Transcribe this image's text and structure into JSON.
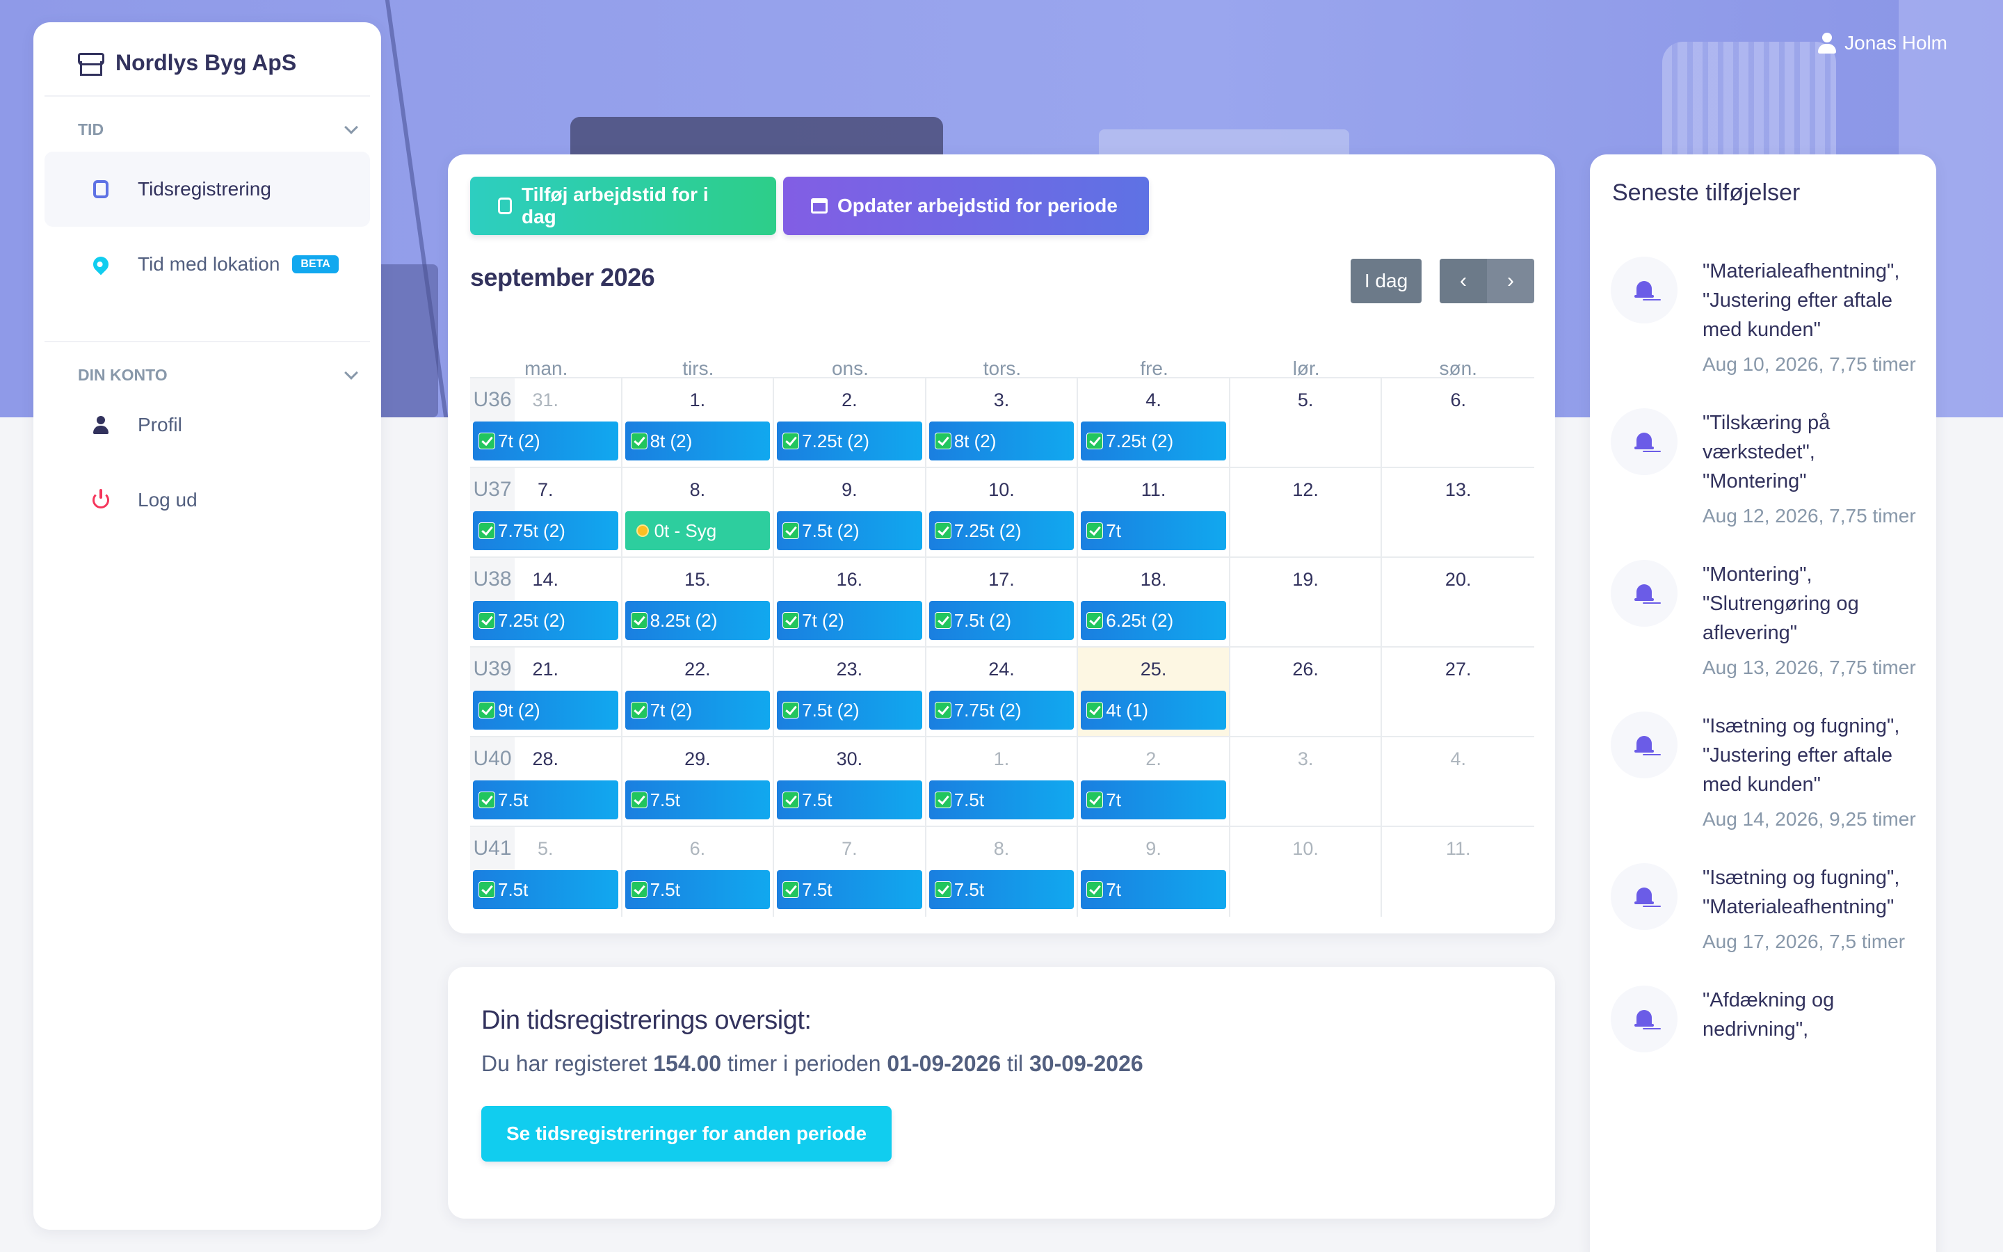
{
  "user": {
    "name": "Jonas Holm"
  },
  "sidebar": {
    "brand": "Nordlys Byg ApS",
    "sections": [
      {
        "title": "TID",
        "items": [
          {
            "label": "Tidsregistrering",
            "icon": "stopwatch-icon",
            "active": true
          },
          {
            "label": "Tid med lokation",
            "icon": "map-pin-icon",
            "badge": "BETA"
          }
        ]
      },
      {
        "title": "DIN KONTO",
        "items": [
          {
            "label": "Profil",
            "icon": "user-icon"
          },
          {
            "label": "Log ud",
            "icon": "power-icon"
          }
        ]
      }
    ]
  },
  "calendar": {
    "add_today_label": "Tilføj arbejdstid for i dag",
    "update_period_label": "Opdater arbejdstid for periode",
    "month_title": "september 2026",
    "today_label": "I dag",
    "prev_label": "‹",
    "next_label": "›",
    "weekdays": [
      "man.",
      "tirs.",
      "ons.",
      "tors.",
      "fre.",
      "lør.",
      "søn."
    ],
    "weeks": [
      {
        "label": "U36",
        "days": [
          {
            "n": "31.",
            "dim": true,
            "ev": "7t (2)"
          },
          {
            "n": "1.",
            "ev": "8t (2)"
          },
          {
            "n": "2.",
            "ev": "7.25t (2)"
          },
          {
            "n": "3.",
            "ev": "8t (2)"
          },
          {
            "n": "4.",
            "ev": "7.25t (2)"
          },
          {
            "n": "5."
          },
          {
            "n": "6."
          }
        ]
      },
      {
        "label": "U37",
        "days": [
          {
            "n": "7.",
            "ev": "7.75t (2)"
          },
          {
            "n": "8.",
            "ev": "0t - Syg",
            "sick": true
          },
          {
            "n": "9.",
            "ev": "7.5t (2)"
          },
          {
            "n": "10.",
            "ev": "7.25t (2)"
          },
          {
            "n": "11.",
            "ev": "7t"
          },
          {
            "n": "12."
          },
          {
            "n": "13."
          }
        ]
      },
      {
        "label": "U38",
        "days": [
          {
            "n": "14.",
            "ev": "7.25t (2)"
          },
          {
            "n": "15.",
            "ev": "8.25t (2)"
          },
          {
            "n": "16.",
            "ev": "7t (2)"
          },
          {
            "n": "17.",
            "ev": "7.5t (2)"
          },
          {
            "n": "18.",
            "ev": "6.25t (2)"
          },
          {
            "n": "19."
          },
          {
            "n": "20."
          }
        ]
      },
      {
        "label": "U39",
        "days": [
          {
            "n": "21.",
            "ev": "9t (2)"
          },
          {
            "n": "22.",
            "ev": "7t (2)"
          },
          {
            "n": "23.",
            "ev": "7.5t (2)"
          },
          {
            "n": "24.",
            "ev": "7.75t (2)"
          },
          {
            "n": "25.",
            "ev": "4t (1)",
            "today": true
          },
          {
            "n": "26."
          },
          {
            "n": "27."
          }
        ]
      },
      {
        "label": "U40",
        "days": [
          {
            "n": "28.",
            "ev": "7.5t"
          },
          {
            "n": "29.",
            "ev": "7.5t"
          },
          {
            "n": "30.",
            "ev": "7.5t"
          },
          {
            "n": "1.",
            "dim": true,
            "ev": "7.5t"
          },
          {
            "n": "2.",
            "dim": true,
            "ev": "7t"
          },
          {
            "n": "3.",
            "dim": true
          },
          {
            "n": "4.",
            "dim": true
          }
        ]
      },
      {
        "label": "U41",
        "days": [
          {
            "n": "5.",
            "dim": true,
            "ev": "7.5t"
          },
          {
            "n": "6.",
            "dim": true,
            "ev": "7.5t"
          },
          {
            "n": "7.",
            "dim": true,
            "ev": "7.5t"
          },
          {
            "n": "8.",
            "dim": true,
            "ev": "7.5t"
          },
          {
            "n": "9.",
            "dim": true,
            "ev": "7t"
          },
          {
            "n": "10.",
            "dim": true
          },
          {
            "n": "11.",
            "dim": true
          }
        ]
      }
    ]
  },
  "overview": {
    "title": "Din tidsregistrerings oversigt:",
    "text_1": "Du har registeret ",
    "hours": "154.00",
    "text_2": " timer i perioden ",
    "from": "01-09-2026",
    "text_3": " til ",
    "to": "30-09-2026",
    "button_label": "Se tidsregistreringer for anden periode"
  },
  "recent": {
    "title": "Seneste tilføjelser",
    "items": [
      {
        "text": "\"Materialeafhentning\", \"Justering efter aftale med kunden\"",
        "meta": "Aug 10, 2026, 7,75 timer"
      },
      {
        "text": "\"Tilskæring på værkstedet\", \"Montering\"",
        "meta": "Aug 12, 2026, 7,75 timer"
      },
      {
        "text": "\"Montering\", \"Slutrengøring og aflevering\"",
        "meta": "Aug 13, 2026, 7,75 timer"
      },
      {
        "text": "\"Isætning og fugning\", \"Justering efter aftale med kunden\"",
        "meta": "Aug 14, 2026, 9,25 timer"
      },
      {
        "text": "\"Isætning og fugning\", \"Materialeafhentning\"",
        "meta": "Aug 17, 2026, 7,5 timer"
      },
      {
        "text": "\"Afdækning og nedrivning\",",
        "meta": ""
      }
    ]
  }
}
